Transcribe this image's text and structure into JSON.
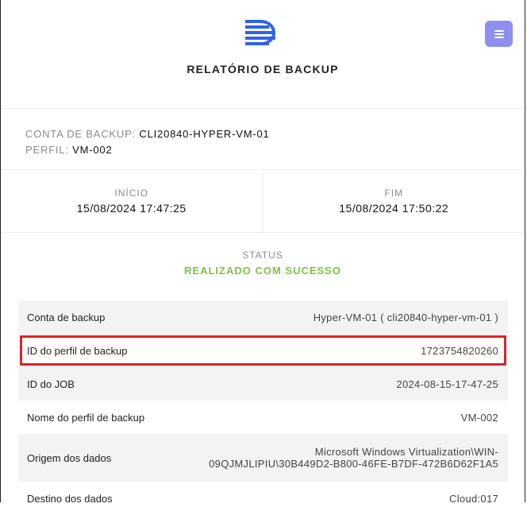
{
  "header": {
    "title": "RELATÓRIO DE BACKUP",
    "logo_icon": "brand-logo",
    "menu_icon": "hamburger-icon",
    "accent": "#8f8ff0",
    "logo_color": "#2f63e8"
  },
  "account": {
    "conta_label": "CONTA DE BACKUP:",
    "conta_value": "CLI20840-HYPER-VM-01",
    "perfil_label": "PERFIL:",
    "perfil_value": "VM-002"
  },
  "times": {
    "inicio_label": "INÍCIO",
    "inicio_value": "15/08/2024 17:47:25",
    "fim_label": "FIM",
    "fim_value": "15/08/2024 17:50:22"
  },
  "status": {
    "label": "STATUS",
    "value": "REALIZADO COM SUCESSO",
    "color": "#7cc242"
  },
  "details": [
    {
      "key": "Conta de backup",
      "value": "Hyper-VM-01 ( cli20840-hyper-vm-01 )"
    },
    {
      "key": "ID do perfil de backup",
      "value": "1723754820260"
    },
    {
      "key": "ID do JOB",
      "value": "2024-08-15-17-47-25"
    },
    {
      "key": "Nome do perfil de backup",
      "value": "VM-002"
    },
    {
      "key": "Origem dos dados",
      "value_line1": "Microsoft Windows Virtualization\\WIN-",
      "value_line2": "09QJMJLIPIU\\30B449D2-B800-46FE-B7DF-472B6D62F1A5"
    },
    {
      "key": "Destino dos dados",
      "value": "Cloud:017"
    }
  ],
  "highlight_color": "#dd2222"
}
